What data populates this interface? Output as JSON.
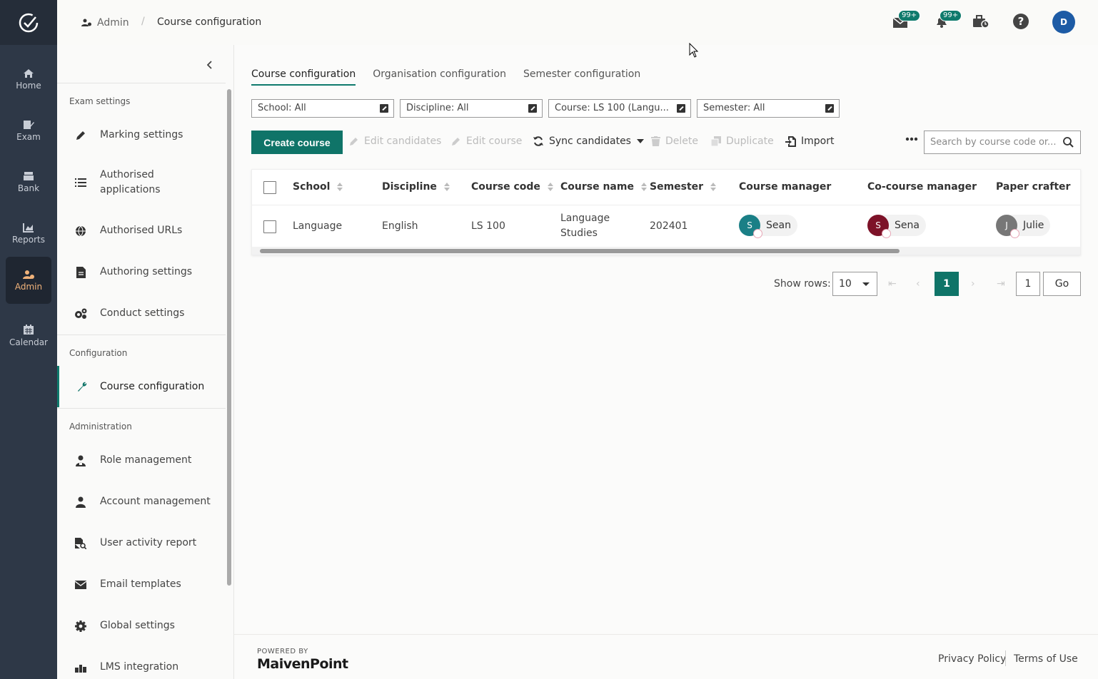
{
  "header": {
    "breadcrumb_root": "Admin",
    "breadcrumb_sep": "/",
    "breadcrumb_current": "Course configuration",
    "mail_badge": "99+",
    "notify_badge": "99+",
    "avatar_initial": "D"
  },
  "rail": {
    "items": [
      {
        "label": "Home",
        "icon": "home-icon"
      },
      {
        "label": "Exam",
        "icon": "exam-icon"
      },
      {
        "label": "Bank",
        "icon": "bank-icon"
      },
      {
        "label": "Reports",
        "icon": "reports-icon"
      },
      {
        "label": "Admin",
        "icon": "admin-icon"
      },
      {
        "label": "Calendar",
        "icon": "calendar-icon"
      }
    ],
    "active": "Admin"
  },
  "sidebar": {
    "section_exam": "Exam settings",
    "exam_items": [
      {
        "label": "Marking settings"
      },
      {
        "label": "Authorised applications"
      },
      {
        "label": "Authorised URLs"
      },
      {
        "label": "Authoring settings"
      },
      {
        "label": "Conduct settings"
      }
    ],
    "section_config": "Configuration",
    "config_items": [
      {
        "label": "Course configuration"
      }
    ],
    "section_admin": "Administration",
    "admin_items": [
      {
        "label": "Role management"
      },
      {
        "label": "Account management"
      },
      {
        "label": "User activity report"
      },
      {
        "label": "Email templates"
      },
      {
        "label": "Global settings"
      },
      {
        "label": "LMS integration"
      }
    ]
  },
  "tabs": [
    {
      "label": "Course configuration"
    },
    {
      "label": "Organisation configuration"
    },
    {
      "label": "Semester configuration"
    }
  ],
  "filters": {
    "school": "School: All",
    "discipline": "Discipline: All",
    "course": "Course: LS 100 (Langu...",
    "semester": "Semester: All"
  },
  "toolbar": {
    "create": "Create course",
    "edit_candidates": "Edit candidates",
    "edit_course": "Edit course",
    "sync": "Sync candidates",
    "delete": "Delete",
    "duplicate": "Duplicate",
    "import": "Import",
    "search_placeholder": "Search by course code or..."
  },
  "table": {
    "columns": [
      "School",
      "Discipline",
      "Course code",
      "Course name",
      "Semester",
      "Course manager",
      "Co-course manager",
      "Paper crafter"
    ],
    "rows": [
      {
        "school": "Language",
        "discipline": "English",
        "course_code": "LS 100",
        "course_name_line1": "Language",
        "course_name_line2": "Studies",
        "semester": "202401",
        "course_manager": {
          "initial": "S",
          "name": "Sean",
          "color": "#1a7f86"
        },
        "co_course_manager": {
          "initial": "S",
          "name": "Sena",
          "color": "#7d1228"
        },
        "paper_crafter": {
          "initial": "J",
          "name": "Julie",
          "color": "#777777"
        }
      }
    ]
  },
  "pagination": {
    "show_rows_label": "Show rows:",
    "rows_value": "10",
    "current_page": "1",
    "page_input": "1",
    "go": "Go"
  },
  "footer": {
    "powered": "POWERED BY",
    "brand": "MaivenPoint",
    "privacy": "Privacy Policy",
    "terms": "Terms of Use"
  },
  "colors": {
    "accent": "#0f7468",
    "rail_bg": "#2e3847",
    "admin_active": "#f0b27a"
  }
}
